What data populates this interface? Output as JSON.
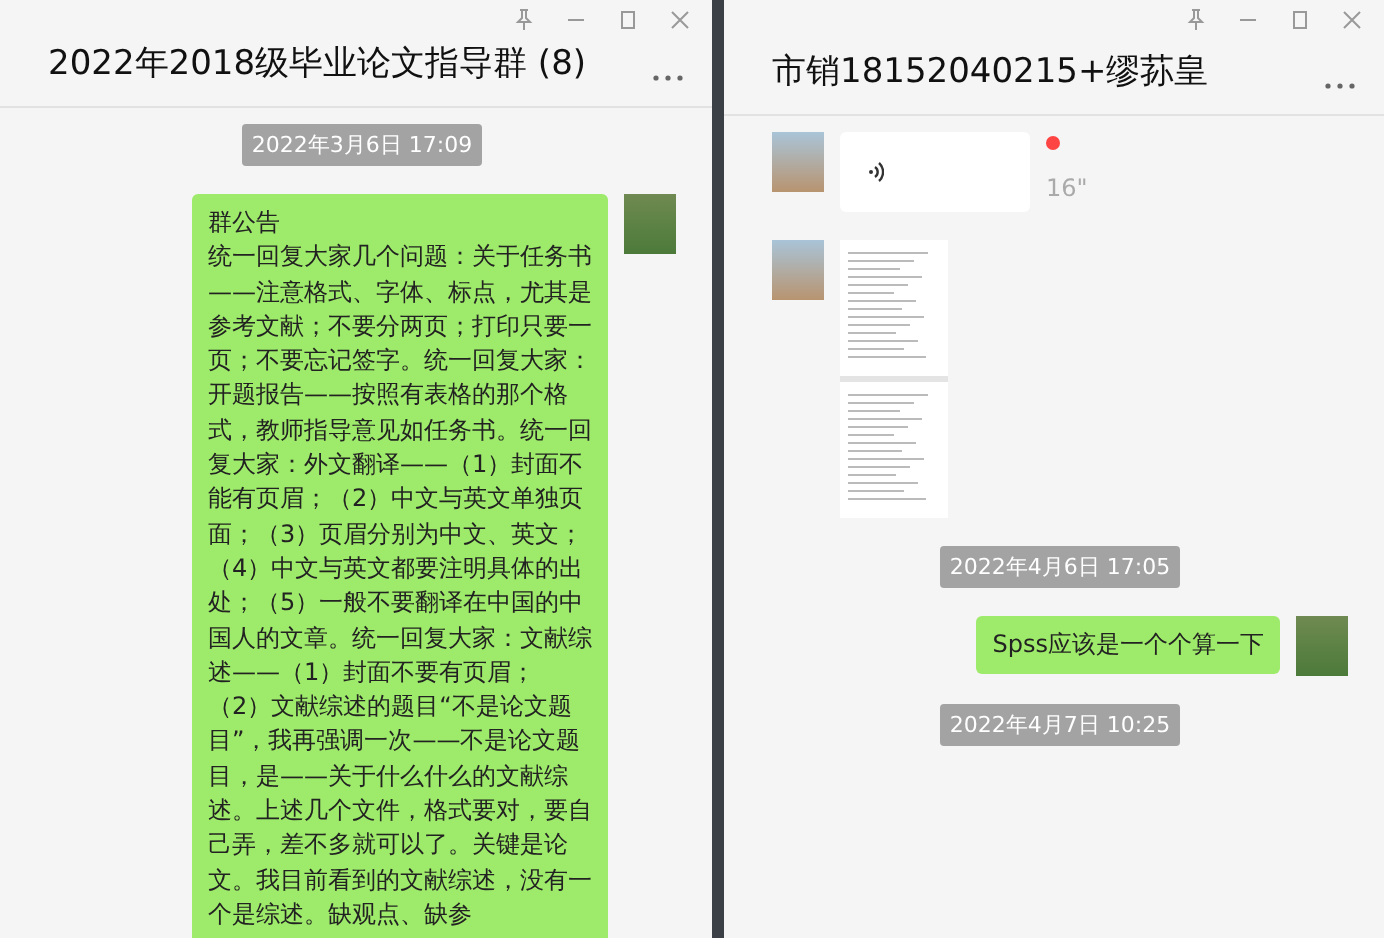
{
  "windows": [
    {
      "title": "2022年2018级毕业论文指导群 (8)",
      "messages": [
        {
          "kind": "time",
          "text": "2022年3月6日 17:09"
        },
        {
          "kind": "text",
          "outgoing": true,
          "title": "群公告",
          "text": "统一回复大家几个问题：关于任务书——注意格式、字体、标点，尤其是参考文献；不要分两页；打印只要一页；不要忘记签字。统一回复大家：开题报告——按照有表格的那个格式，教师指导意见如任务书。统一回复大家：外文翻译——（1）封面不能有页眉；（2）中文与英文单独页面；（3）页眉分别为中文、英文；（4）中文与英文都要注明具体的出处；（5）一般不要翻译在中国的中国人的文章。统一回复大家：文献综述——（1）封面不要有页眉；（2）文献综述的题目“不是论文题目”，我再强调一次——不是论文题目，是——关于什么什么的文献综述。上述几个文件，格式要对，要自己弄，差不多就可以了。关键是论文。我目前看到的文献综述，没有一个是综述。缺观点、缺参"
        }
      ]
    },
    {
      "title": "市销18152040215+缪荪皇",
      "messages": [
        {
          "kind": "voice",
          "outgoing": false,
          "duration": "16\"",
          "unread": true
        },
        {
          "kind": "image",
          "outgoing": false
        },
        {
          "kind": "time",
          "text": "2022年4月6日 17:05"
        },
        {
          "kind": "text",
          "outgoing": true,
          "text": "Spss应该是一个个算一下"
        },
        {
          "kind": "time",
          "text": "2022年4月7日 10:25"
        }
      ]
    }
  ]
}
